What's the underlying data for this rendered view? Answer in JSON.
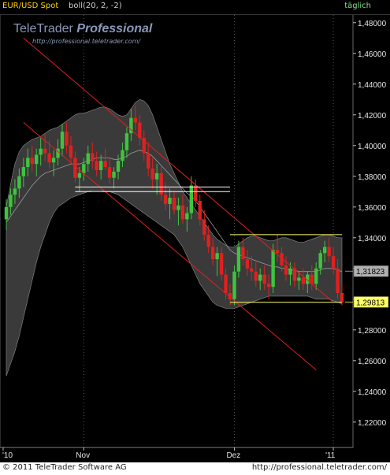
{
  "header": {
    "symbol": "EUR/USD Spot",
    "indicator": "boll(20, 2, -2)",
    "period": "täglich"
  },
  "logo": {
    "line1_plain": "TeleTrader",
    "line1_bold": "Professional",
    "line2": "http://professional.teletrader.com/"
  },
  "footer": {
    "copyright": "© 2011 TeleTrader Software AG",
    "site": "http://professional.teletrader.com/"
  },
  "colors": {
    "background": "#000000",
    "up_candle": "#3ec43e",
    "down_candle": "#e02020",
    "band_fill": "#3a3a3a",
    "band_line": "#8c8c8c",
    "trend_line": "#e02020",
    "support_line": "#ffffff",
    "range_line": "#ffff66"
  },
  "chart_data": {
    "type": "candlestick",
    "title": "EUR/USD Spot",
    "ylim": [
      1.2,
      1.49
    ],
    "y_ticks": [
      "1,48000",
      "1,46000",
      "1,44000",
      "1,42000",
      "1,40000",
      "1,38000",
      "1,36000",
      "1,34000",
      "1,32000",
      "1,30000",
      "1,28000",
      "1,26000",
      "1,24000",
      "1,22000"
    ],
    "x_ticks": [
      "'10",
      "Nov",
      "Dez",
      "'11"
    ],
    "price_labels": [
      {
        "label": "1,31823",
        "value": 1.31823
      },
      {
        "label": "1,29813",
        "value": 1.29813
      }
    ],
    "ohlc": [
      [
        1.352,
        1.365,
        1.345,
        1.36
      ],
      [
        1.36,
        1.372,
        1.355,
        1.368
      ],
      [
        1.368,
        1.378,
        1.362,
        1.372
      ],
      [
        1.372,
        1.385,
        1.366,
        1.38
      ],
      [
        1.38,
        1.392,
        1.373,
        1.386
      ],
      [
        1.386,
        1.398,
        1.38,
        1.392
      ],
      [
        1.392,
        1.4,
        1.383,
        1.388
      ],
      [
        1.388,
        1.398,
        1.38,
        1.394
      ],
      [
        1.394,
        1.405,
        1.387,
        1.398
      ],
      [
        1.398,
        1.408,
        1.39,
        1.395
      ],
      [
        1.395,
        1.403,
        1.385,
        1.389
      ],
      [
        1.389,
        1.397,
        1.38,
        1.392
      ],
      [
        1.392,
        1.404,
        1.387,
        1.398
      ],
      [
        1.398,
        1.414,
        1.393,
        1.409
      ],
      [
        1.409,
        1.415,
        1.395,
        1.4
      ],
      [
        1.4,
        1.406,
        1.388,
        1.392
      ],
      [
        1.392,
        1.396,
        1.376,
        1.379
      ],
      [
        1.379,
        1.386,
        1.37,
        1.382
      ],
      [
        1.382,
        1.392,
        1.377,
        1.388
      ],
      [
        1.388,
        1.4,
        1.383,
        1.395
      ],
      [
        1.395,
        1.402,
        1.385,
        1.39
      ],
      [
        1.39,
        1.396,
        1.38,
        1.384
      ],
      [
        1.384,
        1.394,
        1.378,
        1.39
      ],
      [
        1.39,
        1.398,
        1.384,
        1.386
      ],
      [
        1.386,
        1.392,
        1.375,
        1.379
      ],
      [
        1.379,
        1.386,
        1.372,
        1.383
      ],
      [
        1.383,
        1.394,
        1.378,
        1.39
      ],
      [
        1.39,
        1.402,
        1.386,
        1.397
      ],
      [
        1.397,
        1.412,
        1.392,
        1.408
      ],
      [
        1.408,
        1.424,
        1.403,
        1.418
      ],
      [
        1.418,
        1.426,
        1.41,
        1.415
      ],
      [
        1.415,
        1.42,
        1.4,
        1.405
      ],
      [
        1.405,
        1.41,
        1.39,
        1.395
      ],
      [
        1.395,
        1.402,
        1.38,
        1.385
      ],
      [
        1.385,
        1.392,
        1.372,
        1.378
      ],
      [
        1.378,
        1.388,
        1.368,
        1.382
      ],
      [
        1.382,
        1.386,
        1.364,
        1.368
      ],
      [
        1.368,
        1.376,
        1.358,
        1.362
      ],
      [
        1.362,
        1.372,
        1.352,
        1.366
      ],
      [
        1.366,
        1.37,
        1.355,
        1.358
      ],
      [
        1.358,
        1.366,
        1.348,
        1.361
      ],
      [
        1.361,
        1.368,
        1.349,
        1.352
      ],
      [
        1.352,
        1.36,
        1.344,
        1.356
      ],
      [
        1.356,
        1.38,
        1.352,
        1.374
      ],
      [
        1.374,
        1.378,
        1.36,
        1.364
      ],
      [
        1.364,
        1.368,
        1.348,
        1.352
      ],
      [
        1.352,
        1.358,
        1.338,
        1.342
      ],
      [
        1.342,
        1.348,
        1.33,
        1.334
      ],
      [
        1.334,
        1.34,
        1.322,
        1.326
      ],
      [
        1.326,
        1.334,
        1.315,
        1.33
      ],
      [
        1.33,
        1.334,
        1.312,
        1.316
      ],
      [
        1.316,
        1.32,
        1.3,
        1.304
      ],
      [
        1.304,
        1.31,
        1.296,
        1.3
      ],
      [
        1.3,
        1.322,
        1.296,
        1.318
      ],
      [
        1.318,
        1.338,
        1.314,
        1.334
      ],
      [
        1.334,
        1.34,
        1.322,
        1.326
      ],
      [
        1.326,
        1.332,
        1.315,
        1.32
      ],
      [
        1.32,
        1.328,
        1.312,
        1.318
      ],
      [
        1.318,
        1.324,
        1.308,
        1.312
      ],
      [
        1.312,
        1.32,
        1.306,
        1.316
      ],
      [
        1.316,
        1.322,
        1.306,
        1.31
      ],
      [
        1.31,
        1.316,
        1.3,
        1.308
      ],
      [
        1.308,
        1.336,
        1.304,
        1.332
      ],
      [
        1.332,
        1.342,
        1.324,
        1.33
      ],
      [
        1.33,
        1.334,
        1.318,
        1.322
      ],
      [
        1.322,
        1.328,
        1.312,
        1.316
      ],
      [
        1.316,
        1.324,
        1.309,
        1.32
      ],
      [
        1.32,
        1.324,
        1.308,
        1.312
      ],
      [
        1.312,
        1.318,
        1.306,
        1.314
      ],
      [
        1.314,
        1.32,
        1.306,
        1.31
      ],
      [
        1.31,
        1.318,
        1.304,
        1.316
      ],
      [
        1.316,
        1.322,
        1.306,
        1.31
      ],
      [
        1.31,
        1.324,
        1.306,
        1.32
      ],
      [
        1.32,
        1.332,
        1.316,
        1.33
      ],
      [
        1.33,
        1.338,
        1.324,
        1.334
      ],
      [
        1.334,
        1.34,
        1.324,
        1.328
      ],
      [
        1.328,
        1.334,
        1.316,
        1.32
      ],
      [
        1.32,
        1.326,
        1.3,
        1.304
      ],
      [
        1.304,
        1.31,
        1.296,
        1.298
      ]
    ],
    "bollinger": {
      "period": 20,
      "upper": [
        1.36,
        1.375,
        1.388,
        1.396,
        1.4,
        1.402,
        1.404,
        1.405,
        1.406,
        1.408,
        1.41,
        1.411,
        1.412,
        1.414,
        1.416,
        1.418,
        1.42,
        1.421,
        1.421,
        1.422,
        1.423,
        1.424,
        1.425,
        1.425,
        1.424,
        1.422,
        1.42,
        1.419,
        1.42,
        1.424,
        1.428,
        1.43,
        1.429,
        1.426,
        1.42,
        1.412,
        1.404,
        1.396,
        1.388,
        1.382,
        1.376,
        1.37,
        1.366,
        1.362,
        1.358,
        1.354,
        1.35,
        1.346,
        1.342,
        1.339,
        1.337,
        1.335,
        1.334,
        1.334,
        1.336,
        1.338,
        1.34,
        1.341,
        1.341,
        1.34,
        1.339,
        1.338,
        1.338,
        1.339,
        1.34,
        1.34,
        1.339,
        1.338,
        1.337,
        1.337,
        1.338,
        1.339,
        1.34,
        1.341,
        1.342,
        1.342,
        1.341,
        1.34,
        1.34
      ],
      "middle": [
        1.35,
        1.354,
        1.358,
        1.362,
        1.366,
        1.37,
        1.374,
        1.377,
        1.38,
        1.382,
        1.383,
        1.384,
        1.385,
        1.386,
        1.387,
        1.388,
        1.388,
        1.388,
        1.389,
        1.39,
        1.391,
        1.392,
        1.392,
        1.392,
        1.392,
        1.391,
        1.391,
        1.392,
        1.393,
        1.395,
        1.396,
        1.397,
        1.396,
        1.395,
        1.393,
        1.39,
        1.387,
        1.384,
        1.381,
        1.378,
        1.375,
        1.372,
        1.369,
        1.367,
        1.364,
        1.36,
        1.356,
        1.352,
        1.348,
        1.344,
        1.34,
        1.336,
        1.332,
        1.33,
        1.329,
        1.328,
        1.327,
        1.326,
        1.325,
        1.324,
        1.323,
        1.322,
        1.321,
        1.321,
        1.32,
        1.32,
        1.319,
        1.319,
        1.318,
        1.318,
        1.318,
        1.318,
        1.318,
        1.319,
        1.32,
        1.32,
        1.32,
        1.319,
        1.318
      ],
      "lower": [
        1.25,
        1.258,
        1.266,
        1.276,
        1.288,
        1.3,
        1.312,
        1.324,
        1.334,
        1.342,
        1.35,
        1.356,
        1.36,
        1.362,
        1.364,
        1.366,
        1.367,
        1.368,
        1.369,
        1.37,
        1.371,
        1.371,
        1.371,
        1.37,
        1.37,
        1.369,
        1.368,
        1.366,
        1.364,
        1.362,
        1.36,
        1.358,
        1.356,
        1.354,
        1.352,
        1.35,
        1.348,
        1.346,
        1.344,
        1.342,
        1.338,
        1.334,
        1.328,
        1.322,
        1.316,
        1.31,
        1.306,
        1.302,
        1.298,
        1.296,
        1.295,
        1.294,
        1.294,
        1.294,
        1.295,
        1.296,
        1.297,
        1.298,
        1.299,
        1.3,
        1.301,
        1.302,
        1.302,
        1.302,
        1.302,
        1.302,
        1.302,
        1.302,
        1.302,
        1.302,
        1.302,
        1.301,
        1.3,
        1.3,
        1.3,
        1.3,
        1.299,
        1.298,
        1.297
      ]
    },
    "trendlines": [
      {
        "i1": 4,
        "p1": 1.47,
        "i2": 76,
        "p2": 1.298,
        "color": "red"
      },
      {
        "i1": 4,
        "p1": 1.415,
        "i2": 72,
        "p2": 1.254,
        "color": "red"
      }
    ],
    "horizontal_lines": [
      {
        "i1": 16,
        "i2": 52,
        "p": 1.373,
        "color": "white"
      },
      {
        "i1": 16,
        "i2": 52,
        "p": 1.37,
        "color": "white"
      },
      {
        "i1": 52,
        "i2": 78,
        "p": 1.342,
        "color": "yellow"
      },
      {
        "i1": 52,
        "i2": 78,
        "p": 1.298,
        "color": "yellow"
      }
    ]
  }
}
